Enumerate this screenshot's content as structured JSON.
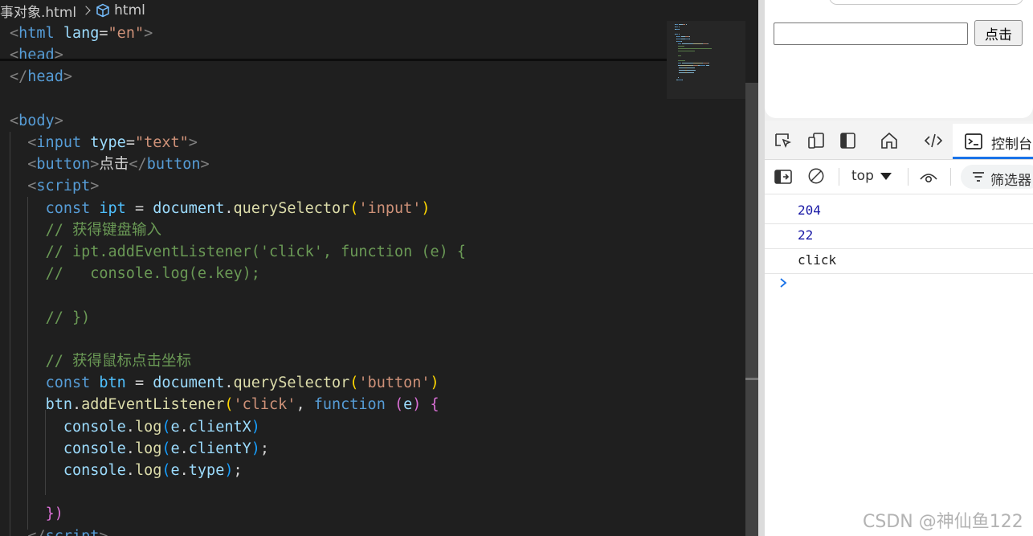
{
  "editor": {
    "breadcrumb": {
      "file": "事对象.html",
      "symbol": "html"
    },
    "lines": [
      {
        "tokens": [
          [
            "t-br",
            "<"
          ],
          [
            "t-tag",
            "html"
          ],
          [
            "t-txt",
            " "
          ],
          [
            "t-attr",
            "lang"
          ],
          [
            "t-txt",
            "="
          ],
          [
            "t-str",
            "\"en\""
          ],
          [
            "t-br",
            ">"
          ]
        ]
      },
      {
        "tokens": [
          [
            "t-br",
            "<"
          ],
          [
            "t-tag",
            "head"
          ],
          [
            "t-br",
            ">"
          ]
        ]
      },
      {
        "tokens": [
          [
            "t-br",
            "</"
          ],
          [
            "t-tag",
            "head"
          ],
          [
            "t-br",
            ">"
          ]
        ]
      },
      {
        "tokens": []
      },
      {
        "tokens": [
          [
            "t-br",
            "<"
          ],
          [
            "t-tag",
            "body"
          ],
          [
            "t-br",
            ">"
          ]
        ]
      },
      {
        "tokens": [
          [
            "t-txt",
            "  "
          ],
          [
            "t-br",
            "<"
          ],
          [
            "t-tag",
            "input"
          ],
          [
            "t-txt",
            " "
          ],
          [
            "t-attr",
            "type"
          ],
          [
            "t-txt",
            "="
          ],
          [
            "t-str",
            "\"text\""
          ],
          [
            "t-br",
            ">"
          ]
        ]
      },
      {
        "tokens": [
          [
            "t-txt",
            "  "
          ],
          [
            "t-br",
            "<"
          ],
          [
            "t-tag",
            "button"
          ],
          [
            "t-br",
            ">"
          ],
          [
            "t-txt",
            "点击"
          ],
          [
            "t-br",
            "</"
          ],
          [
            "t-tag",
            "button"
          ],
          [
            "t-br",
            ">"
          ]
        ]
      },
      {
        "tokens": [
          [
            "t-txt",
            "  "
          ],
          [
            "t-br",
            "<"
          ],
          [
            "t-tag",
            "script"
          ],
          [
            "t-br",
            ">"
          ]
        ]
      },
      {
        "tokens": [
          [
            "t-txt",
            "    "
          ],
          [
            "t-kw",
            "const"
          ],
          [
            "t-txt",
            " "
          ],
          [
            "t-var",
            "ipt"
          ],
          [
            "t-txt",
            " = "
          ],
          [
            "t-prop",
            "document"
          ],
          [
            "t-txt",
            "."
          ],
          [
            "t-fn",
            "querySelector"
          ],
          [
            "t-p1",
            "("
          ],
          [
            "t-str",
            "'input'"
          ],
          [
            "t-p1",
            ")"
          ]
        ]
      },
      {
        "tokens": [
          [
            "t-txt",
            "    "
          ],
          [
            "t-com",
            "// 获得键盘输入"
          ]
        ]
      },
      {
        "tokens": [
          [
            "t-txt",
            "    "
          ],
          [
            "t-com",
            "// ipt.addEventListener('click', function (e) {"
          ]
        ]
      },
      {
        "tokens": [
          [
            "t-txt",
            "    "
          ],
          [
            "t-com",
            "//   console.log(e.key);"
          ]
        ]
      },
      {
        "tokens": []
      },
      {
        "tokens": [
          [
            "t-txt",
            "    "
          ],
          [
            "t-com",
            "// })"
          ]
        ]
      },
      {
        "tokens": []
      },
      {
        "tokens": [
          [
            "t-txt",
            "    "
          ],
          [
            "t-com",
            "// 获得鼠标点击坐标"
          ]
        ]
      },
      {
        "tokens": [
          [
            "t-txt",
            "    "
          ],
          [
            "t-kw",
            "const"
          ],
          [
            "t-txt",
            " "
          ],
          [
            "t-var",
            "btn"
          ],
          [
            "t-txt",
            " = "
          ],
          [
            "t-prop",
            "document"
          ],
          [
            "t-txt",
            "."
          ],
          [
            "t-fn",
            "querySelector"
          ],
          [
            "t-p1",
            "("
          ],
          [
            "t-str",
            "'button'"
          ],
          [
            "t-p1",
            ")"
          ]
        ]
      },
      {
        "tokens": [
          [
            "t-txt",
            "    "
          ],
          [
            "t-prop",
            "btn"
          ],
          [
            "t-txt",
            "."
          ],
          [
            "t-fn",
            "addEventListener"
          ],
          [
            "t-p1",
            "("
          ],
          [
            "t-str",
            "'click'"
          ],
          [
            "t-txt",
            ", "
          ],
          [
            "t-kw",
            "function"
          ],
          [
            "t-txt",
            " "
          ],
          [
            "t-p2",
            "("
          ],
          [
            "t-prop",
            "e"
          ],
          [
            "t-p2",
            ")"
          ],
          [
            "t-txt",
            " "
          ],
          [
            "t-p2",
            "{"
          ]
        ]
      },
      {
        "tokens": [
          [
            "t-txt",
            "      "
          ],
          [
            "t-prop",
            "console"
          ],
          [
            "t-txt",
            "."
          ],
          [
            "t-fn",
            "log"
          ],
          [
            "t-p3",
            "("
          ],
          [
            "t-prop",
            "e"
          ],
          [
            "t-txt",
            "."
          ],
          [
            "t-prop",
            "clientX"
          ],
          [
            "t-p3",
            ")"
          ]
        ]
      },
      {
        "tokens": [
          [
            "t-txt",
            "      "
          ],
          [
            "t-prop",
            "console"
          ],
          [
            "t-txt",
            "."
          ],
          [
            "t-fn",
            "log"
          ],
          [
            "t-p3",
            "("
          ],
          [
            "t-prop",
            "e"
          ],
          [
            "t-txt",
            "."
          ],
          [
            "t-prop",
            "clientY"
          ],
          [
            "t-p3",
            ")"
          ],
          [
            "t-txt",
            ";"
          ]
        ]
      },
      {
        "tokens": [
          [
            "t-txt",
            "      "
          ],
          [
            "t-prop",
            "console"
          ],
          [
            "t-txt",
            "."
          ],
          [
            "t-fn",
            "log"
          ],
          [
            "t-p3",
            "("
          ],
          [
            "t-prop",
            "e"
          ],
          [
            "t-txt",
            "."
          ],
          [
            "t-prop",
            "type"
          ],
          [
            "t-p3",
            ")"
          ],
          [
            "t-txt",
            ";"
          ]
        ]
      },
      {
        "tokens": []
      },
      {
        "tokens": [
          [
            "t-txt",
            "    "
          ],
          [
            "t-p2",
            "})"
          ]
        ]
      },
      {
        "tokens": [
          [
            "t-txt",
            "  "
          ],
          [
            "t-br",
            "</"
          ],
          [
            "t-tag",
            "script"
          ],
          [
            "t-br",
            ">"
          ]
        ]
      }
    ]
  },
  "browser": {
    "page": {
      "input_value": "",
      "button_label": "点击"
    },
    "devtools": {
      "active_tab": "控制台",
      "context": "top",
      "filter_label": "筛选器",
      "console": [
        "204",
        "22",
        "click"
      ]
    }
  },
  "watermark": "CSDN @神仙鱼122",
  "icons": [
    "cube-icon",
    "inspect-icon",
    "device-icon",
    "dock-icon",
    "home-icon",
    "elements-icon",
    "console-icon",
    "sidebar-icon",
    "clear-icon",
    "eye-icon",
    "filter-icon",
    "chevron-right-icon"
  ],
  "colors": {
    "editor_bg": "#1f1f1f",
    "accent_blue": "#1a73e8"
  }
}
